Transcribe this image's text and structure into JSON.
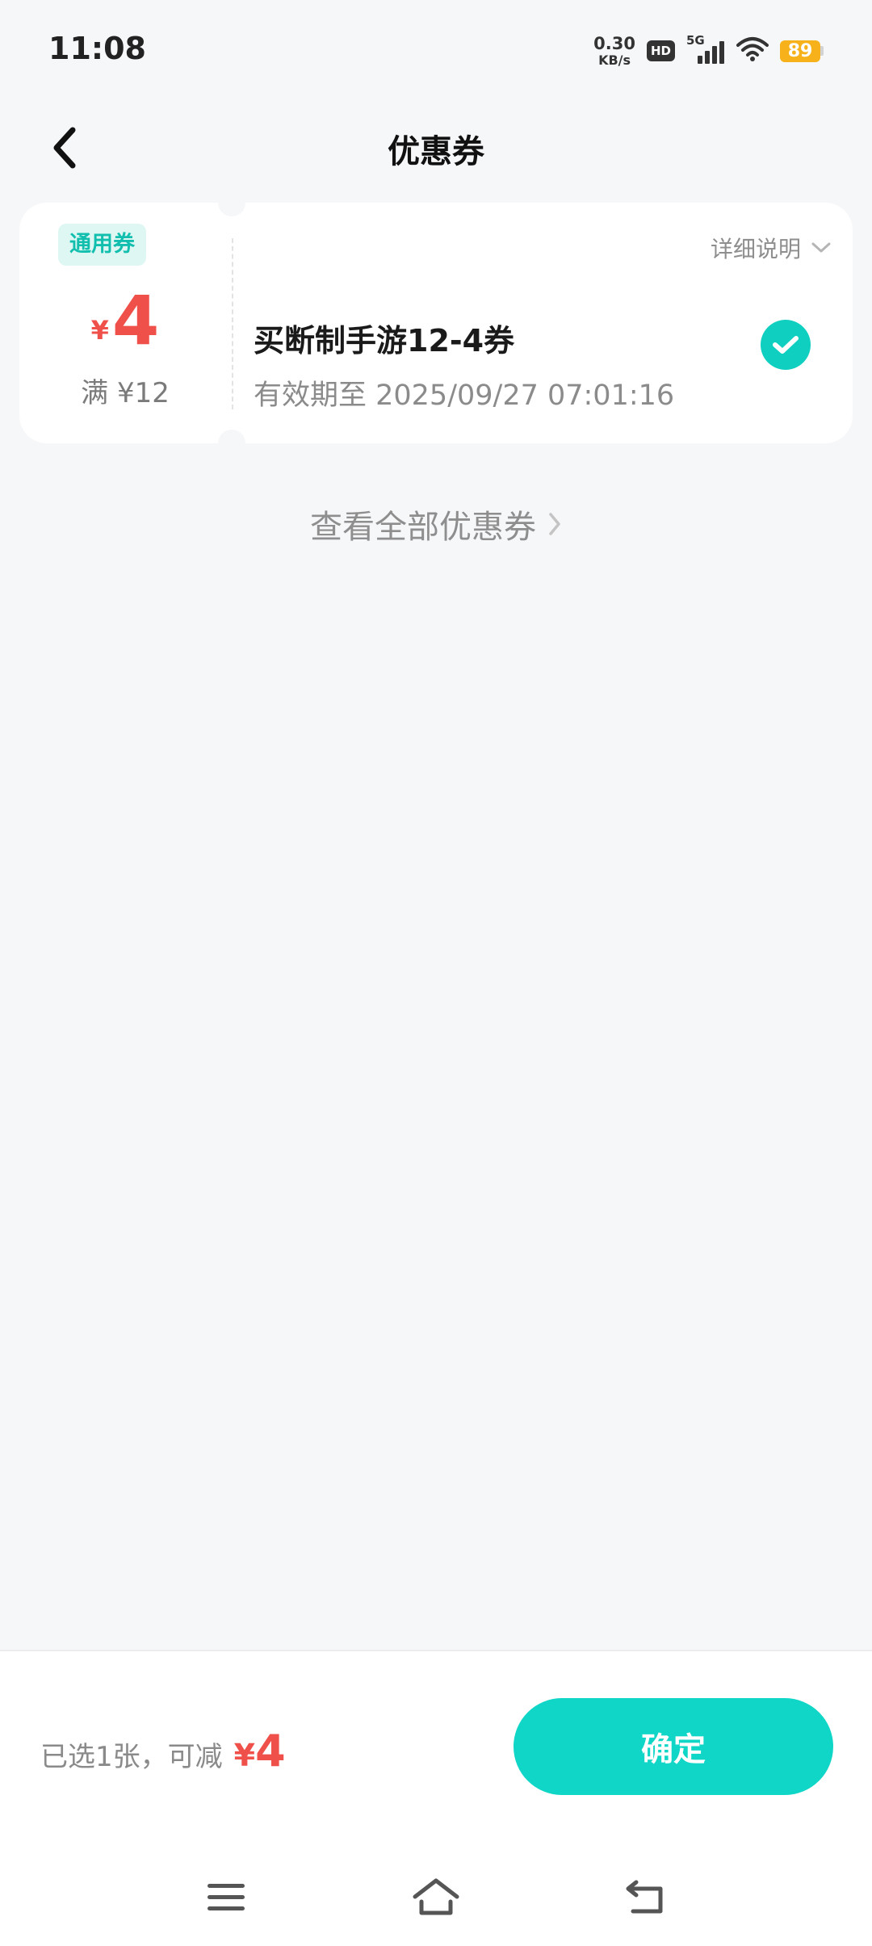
{
  "status_bar": {
    "time": "11:08",
    "net_speed_value": "0.30",
    "net_speed_unit": "KB/s",
    "hd_label": "HD",
    "signal_label": "5G",
    "battery": "89",
    "icons": [
      "hd-icon",
      "signal-5g-icon",
      "wifi-icon",
      "battery-icon"
    ]
  },
  "header": {
    "title": "优惠券",
    "back_icon": "chevron-left-icon"
  },
  "coupon": {
    "tag": "通用券",
    "currency": "¥",
    "amount": "4",
    "min_spend": "满 ¥12",
    "detail_label": "详细说明",
    "name": "买断制手游12-4券",
    "expiry": "有效期至 2025/09/27 07:01:16",
    "selected": true,
    "accent": "#0fd0c0",
    "price_color": "#f0504a"
  },
  "view_all_label": "查看全部优惠券",
  "bottom_bar": {
    "summary_text": "已选1张，可减",
    "currency": "¥",
    "amount": "4",
    "confirm_label": "确定",
    "confirm_color": "#0fd6c6"
  },
  "nav_bar": {
    "icons": [
      "menu-icon",
      "home-icon",
      "back-icon"
    ]
  }
}
